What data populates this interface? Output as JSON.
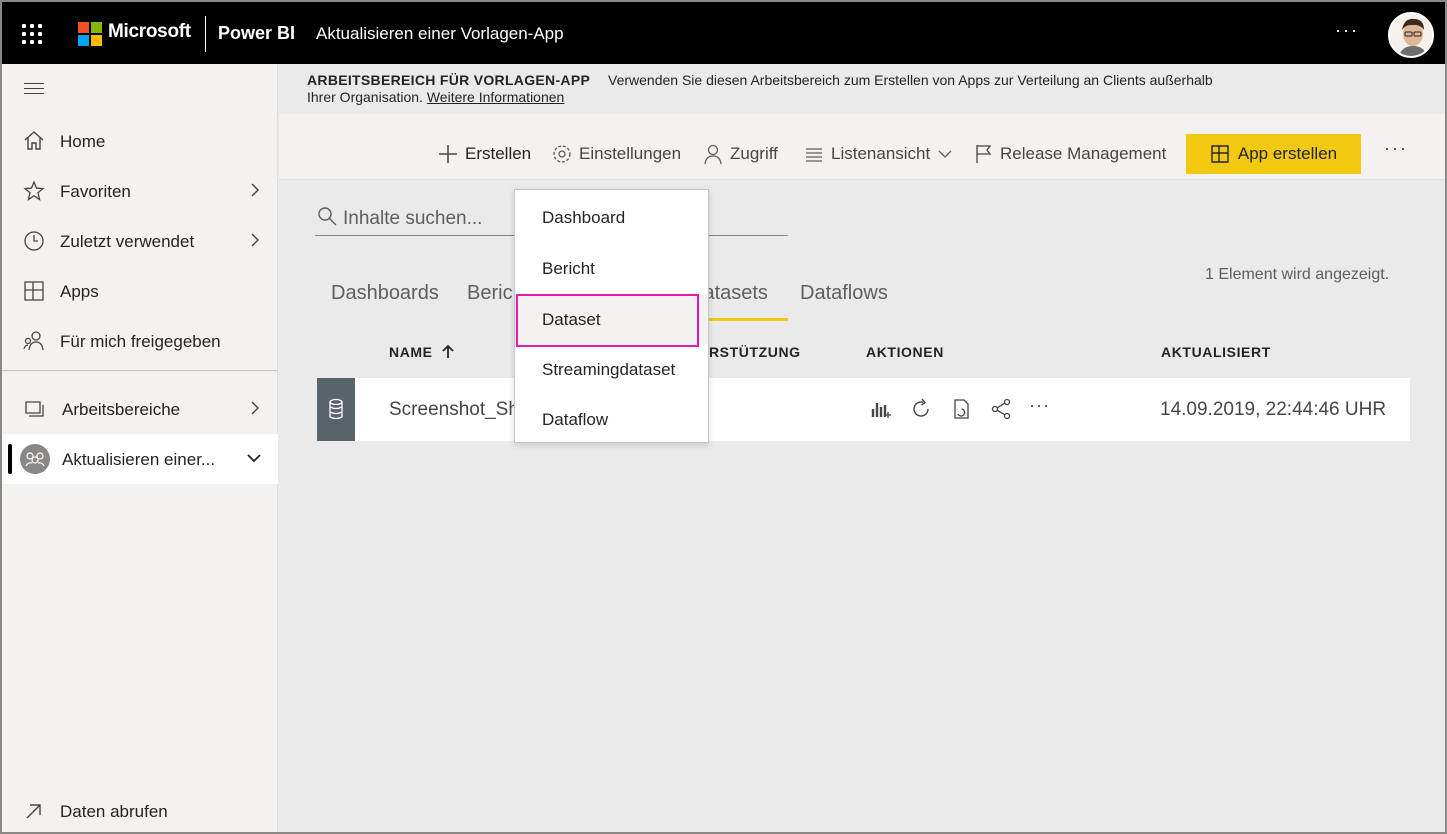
{
  "topbar": {
    "brand": "Microsoft",
    "product": "Power BI",
    "app_title": "Aktualisieren einer Vorlagen-App",
    "more": "···",
    "colors": {
      "bar": "#000000",
      "ms_red": "#f25022",
      "ms_green": "#7fba00",
      "ms_blue": "#00a4ef",
      "ms_yellow": "#ffb900"
    }
  },
  "sidebar": {
    "items": [
      {
        "label": "Home",
        "icon": "home-icon"
      },
      {
        "label": "Favoriten",
        "icon": "star-icon"
      },
      {
        "label": "Zuletzt verwendet",
        "icon": "clock-icon"
      },
      {
        "label": "Apps",
        "icon": "apps-icon"
      },
      {
        "label": "Für mich freigegeben",
        "icon": "shared-icon"
      },
      {
        "label": "Arbeitsbereiche",
        "icon": "workspaces-icon"
      },
      {
        "label": "Aktualisieren einer...",
        "icon": "workspace-avatar-icon"
      }
    ],
    "footer": {
      "label": "Daten abrufen",
      "icon": "arrow-up-right-icon"
    }
  },
  "banner": {
    "title": "ARBEITSBEREICH FÜR VORLAGEN-APP",
    "description_line1": "Verwenden Sie diesen Arbeitsbereich zum Erstellen von Apps zur Verteilung an Clients außerhalb",
    "description_line2": "Ihrer Organisation.",
    "link": "Weitere Informationen"
  },
  "toolbar": {
    "create": "Erstellen",
    "settings": "Einstellungen",
    "access": "Zugriff",
    "view": "Listenansicht",
    "release": "Release Management",
    "create_app": "App erstellen",
    "more": "···",
    "accent": "#f2c811"
  },
  "search": {
    "placeholder": "Inhalte suchen..."
  },
  "count": "1 Element wird angezeigt.",
  "tabs": [
    {
      "label": "Dashboards"
    },
    {
      "label": "Berichte"
    },
    {
      "label": "Datasets"
    },
    {
      "label": "Dataflows"
    }
  ],
  "table": {
    "headers": {
      "name": "NAME",
      "support": "ERSTÜTZUNG",
      "actions": "AKTIONEN",
      "updated": "AKTUALISIERT"
    },
    "rows": [
      {
        "name": "Screenshot_Sh",
        "updated": "14.09.2019, 22:44:46 UHR"
      }
    ],
    "row_more": "···"
  },
  "create_menu": {
    "items": [
      {
        "label": "Dashboard"
      },
      {
        "label": "Bericht"
      },
      {
        "label": "Dataset"
      },
      {
        "label": "Streamingdataset"
      },
      {
        "label": "Dataflow"
      }
    ],
    "highlight_color": "#e31bb2"
  }
}
